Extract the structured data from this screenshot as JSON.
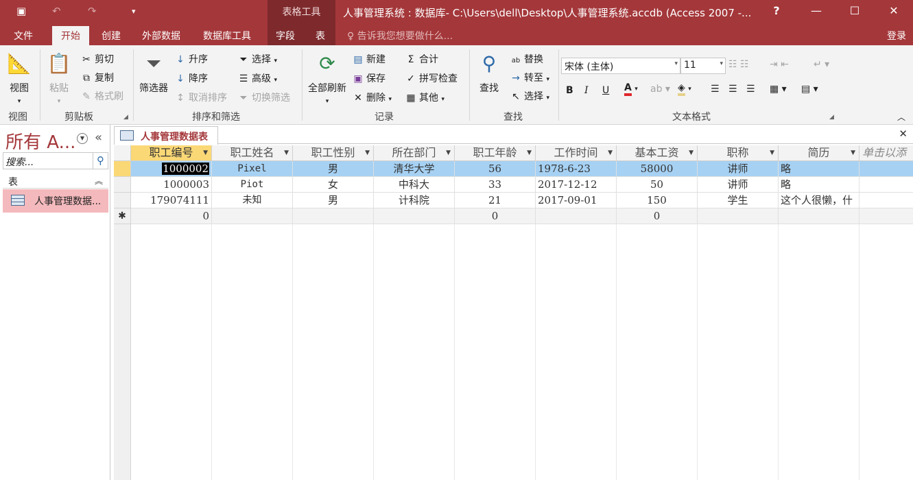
{
  "titlebar": {
    "context_label": "表格工具",
    "title": "人事管理系统 : 数据库- C:\\Users\\dell\\Desktop\\人事管理系统.accdb (Access 2007 -...",
    "help": "?",
    "minimize": "—",
    "maximize": "☐",
    "close": "✕",
    "save_icon": "▣",
    "undo_icon": "↶",
    "redo_icon": "↷",
    "customize_icon": "▾"
  },
  "tabs": {
    "file": "文件",
    "home": "开始",
    "create": "创建",
    "external": "外部数据",
    "dbtools": "数据库工具",
    "fields": "字段",
    "table": "表",
    "tellme": "告诉我您想要做什么...",
    "signin": "登录"
  },
  "ribbon": {
    "views": {
      "view": "视图",
      "group": "视图"
    },
    "clipboard": {
      "paste": "粘贴",
      "cut": "剪切",
      "copy": "复制",
      "format_painter": "格式刷",
      "group": "剪贴板"
    },
    "sort_filter": {
      "filter": "筛选器",
      "asc": "升序",
      "desc": "降序",
      "remove_sort": "取消排序",
      "selection": "选择",
      "advanced": "高级",
      "toggle": "切换筛选",
      "group": "排序和筛选"
    },
    "records": {
      "refresh": "全部刷新",
      "new": "新建",
      "save": "保存",
      "delete": "删除",
      "totals": "合计",
      "spelling": "拼写检查",
      "more": "其他",
      "group": "记录"
    },
    "find": {
      "find": "查找",
      "replace": "替换",
      "goto": "转至",
      "select": "选择",
      "group": "查找"
    },
    "text_format": {
      "font": "宋体 (主体)",
      "size": "11",
      "bold": "B",
      "italic": "I",
      "underline": "U",
      "group": "文本格式"
    }
  },
  "nav": {
    "title": "所有 A...",
    "search_placeholder": "搜索...",
    "group": "表",
    "item": "人事管理数据..."
  },
  "document": {
    "tab": "人事管理数据表",
    "close": "✕"
  },
  "grid": {
    "columns": [
      "职工编号",
      "职工姓名",
      "职工性别",
      "所在部门",
      "职工年龄",
      "工作时间",
      "基本工资",
      "职称",
      "简历",
      "单击以添加"
    ],
    "rows": [
      [
        "1000002",
        "Pixel",
        "男",
        "清华大学",
        "56",
        "1978-6-23",
        "58000",
        "讲师",
        "略"
      ],
      [
        "1000003",
        "Piot",
        "女",
        "中科大",
        "33",
        "2017-12-12",
        "50",
        "讲师",
        "略"
      ],
      [
        "179074111",
        "未知",
        "男",
        "计科院",
        "21",
        "2017-09-01",
        "150",
        "学生",
        "这个人很懒，什"
      ]
    ],
    "new_row": [
      "0",
      "",
      "",
      "",
      "0",
      "",
      "0",
      "",
      ""
    ],
    "new_row_marker": "✱"
  }
}
